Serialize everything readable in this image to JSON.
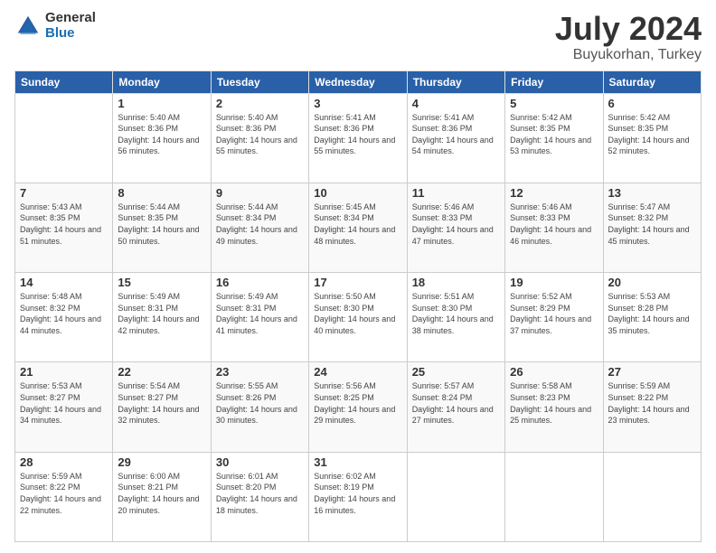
{
  "logo": {
    "general": "General",
    "blue": "Blue"
  },
  "header": {
    "title": "July 2024",
    "subtitle": "Buyukorhan, Turkey"
  },
  "calendar": {
    "days_of_week": [
      "Sunday",
      "Monday",
      "Tuesday",
      "Wednesday",
      "Thursday",
      "Friday",
      "Saturday"
    ],
    "weeks": [
      [
        {
          "day": "",
          "sunrise": "",
          "sunset": "",
          "daylight": ""
        },
        {
          "day": "1",
          "sunrise": "Sunrise: 5:40 AM",
          "sunset": "Sunset: 8:36 PM",
          "daylight": "Daylight: 14 hours and 56 minutes."
        },
        {
          "day": "2",
          "sunrise": "Sunrise: 5:40 AM",
          "sunset": "Sunset: 8:36 PM",
          "daylight": "Daylight: 14 hours and 55 minutes."
        },
        {
          "day": "3",
          "sunrise": "Sunrise: 5:41 AM",
          "sunset": "Sunset: 8:36 PM",
          "daylight": "Daylight: 14 hours and 55 minutes."
        },
        {
          "day": "4",
          "sunrise": "Sunrise: 5:41 AM",
          "sunset": "Sunset: 8:36 PM",
          "daylight": "Daylight: 14 hours and 54 minutes."
        },
        {
          "day": "5",
          "sunrise": "Sunrise: 5:42 AM",
          "sunset": "Sunset: 8:35 PM",
          "daylight": "Daylight: 14 hours and 53 minutes."
        },
        {
          "day": "6",
          "sunrise": "Sunrise: 5:42 AM",
          "sunset": "Sunset: 8:35 PM",
          "daylight": "Daylight: 14 hours and 52 minutes."
        }
      ],
      [
        {
          "day": "7",
          "sunrise": "Sunrise: 5:43 AM",
          "sunset": "Sunset: 8:35 PM",
          "daylight": "Daylight: 14 hours and 51 minutes."
        },
        {
          "day": "8",
          "sunrise": "Sunrise: 5:44 AM",
          "sunset": "Sunset: 8:35 PM",
          "daylight": "Daylight: 14 hours and 50 minutes."
        },
        {
          "day": "9",
          "sunrise": "Sunrise: 5:44 AM",
          "sunset": "Sunset: 8:34 PM",
          "daylight": "Daylight: 14 hours and 49 minutes."
        },
        {
          "day": "10",
          "sunrise": "Sunrise: 5:45 AM",
          "sunset": "Sunset: 8:34 PM",
          "daylight": "Daylight: 14 hours and 48 minutes."
        },
        {
          "day": "11",
          "sunrise": "Sunrise: 5:46 AM",
          "sunset": "Sunset: 8:33 PM",
          "daylight": "Daylight: 14 hours and 47 minutes."
        },
        {
          "day": "12",
          "sunrise": "Sunrise: 5:46 AM",
          "sunset": "Sunset: 8:33 PM",
          "daylight": "Daylight: 14 hours and 46 minutes."
        },
        {
          "day": "13",
          "sunrise": "Sunrise: 5:47 AM",
          "sunset": "Sunset: 8:32 PM",
          "daylight": "Daylight: 14 hours and 45 minutes."
        }
      ],
      [
        {
          "day": "14",
          "sunrise": "Sunrise: 5:48 AM",
          "sunset": "Sunset: 8:32 PM",
          "daylight": "Daylight: 14 hours and 44 minutes."
        },
        {
          "day": "15",
          "sunrise": "Sunrise: 5:49 AM",
          "sunset": "Sunset: 8:31 PM",
          "daylight": "Daylight: 14 hours and 42 minutes."
        },
        {
          "day": "16",
          "sunrise": "Sunrise: 5:49 AM",
          "sunset": "Sunset: 8:31 PM",
          "daylight": "Daylight: 14 hours and 41 minutes."
        },
        {
          "day": "17",
          "sunrise": "Sunrise: 5:50 AM",
          "sunset": "Sunset: 8:30 PM",
          "daylight": "Daylight: 14 hours and 40 minutes."
        },
        {
          "day": "18",
          "sunrise": "Sunrise: 5:51 AM",
          "sunset": "Sunset: 8:30 PM",
          "daylight": "Daylight: 14 hours and 38 minutes."
        },
        {
          "day": "19",
          "sunrise": "Sunrise: 5:52 AM",
          "sunset": "Sunset: 8:29 PM",
          "daylight": "Daylight: 14 hours and 37 minutes."
        },
        {
          "day": "20",
          "sunrise": "Sunrise: 5:53 AM",
          "sunset": "Sunset: 8:28 PM",
          "daylight": "Daylight: 14 hours and 35 minutes."
        }
      ],
      [
        {
          "day": "21",
          "sunrise": "Sunrise: 5:53 AM",
          "sunset": "Sunset: 8:27 PM",
          "daylight": "Daylight: 14 hours and 34 minutes."
        },
        {
          "day": "22",
          "sunrise": "Sunrise: 5:54 AM",
          "sunset": "Sunset: 8:27 PM",
          "daylight": "Daylight: 14 hours and 32 minutes."
        },
        {
          "day": "23",
          "sunrise": "Sunrise: 5:55 AM",
          "sunset": "Sunset: 8:26 PM",
          "daylight": "Daylight: 14 hours and 30 minutes."
        },
        {
          "day": "24",
          "sunrise": "Sunrise: 5:56 AM",
          "sunset": "Sunset: 8:25 PM",
          "daylight": "Daylight: 14 hours and 29 minutes."
        },
        {
          "day": "25",
          "sunrise": "Sunrise: 5:57 AM",
          "sunset": "Sunset: 8:24 PM",
          "daylight": "Daylight: 14 hours and 27 minutes."
        },
        {
          "day": "26",
          "sunrise": "Sunrise: 5:58 AM",
          "sunset": "Sunset: 8:23 PM",
          "daylight": "Daylight: 14 hours and 25 minutes."
        },
        {
          "day": "27",
          "sunrise": "Sunrise: 5:59 AM",
          "sunset": "Sunset: 8:22 PM",
          "daylight": "Daylight: 14 hours and 23 minutes."
        }
      ],
      [
        {
          "day": "28",
          "sunrise": "Sunrise: 5:59 AM",
          "sunset": "Sunset: 8:22 PM",
          "daylight": "Daylight: 14 hours and 22 minutes."
        },
        {
          "day": "29",
          "sunrise": "Sunrise: 6:00 AM",
          "sunset": "Sunset: 8:21 PM",
          "daylight": "Daylight: 14 hours and 20 minutes."
        },
        {
          "day": "30",
          "sunrise": "Sunrise: 6:01 AM",
          "sunset": "Sunset: 8:20 PM",
          "daylight": "Daylight: 14 hours and 18 minutes."
        },
        {
          "day": "31",
          "sunrise": "Sunrise: 6:02 AM",
          "sunset": "Sunset: 8:19 PM",
          "daylight": "Daylight: 14 hours and 16 minutes."
        },
        {
          "day": "",
          "sunrise": "",
          "sunset": "",
          "daylight": ""
        },
        {
          "day": "",
          "sunrise": "",
          "sunset": "",
          "daylight": ""
        },
        {
          "day": "",
          "sunrise": "",
          "sunset": "",
          "daylight": ""
        }
      ]
    ]
  }
}
